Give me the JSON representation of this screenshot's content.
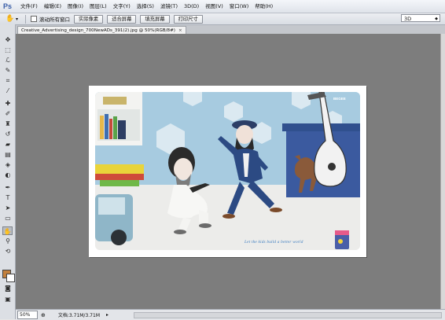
{
  "app": {
    "logo": "Ps"
  },
  "menu": [
    "文件(F)",
    "编辑(E)",
    "图像(I)",
    "图层(L)",
    "文字(Y)",
    "选择(S)",
    "滤镜(T)",
    "3D(D)",
    "视图(V)",
    "窗口(W)",
    "帮助(H)"
  ],
  "options": {
    "scroll_all_label": "滚动所有窗口",
    "buttons": [
      "实际像素",
      "适合屏幕",
      "填充屏幕",
      "打印尺寸"
    ],
    "workspace": "3D"
  },
  "document": {
    "tab_title": "Creative_Advertising_design_700NewADs_391(2).jpg @ 50%(RGB/8#)",
    "close_glyph": "×",
    "brand_text": "BEGEE",
    "tagline": "Let the kids build a better world"
  },
  "status": {
    "zoom": "50%",
    "doc_info": "文档:3.71M/3.71M"
  },
  "icons": {
    "hand_tool": "hand-icon",
    "foreground_color": "#c2803e",
    "background_color": "#ffffff"
  }
}
